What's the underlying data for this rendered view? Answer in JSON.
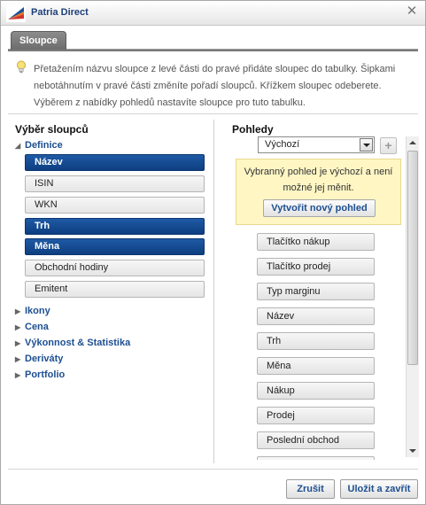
{
  "window": {
    "title": "Patria Direct"
  },
  "tabs": [
    {
      "label": "Sloupce",
      "active": true
    }
  ],
  "info": {
    "lines": [
      "Přetažením názvu sloupce z levé části do pravé přidáte sloupec do tabulky. Šipkami",
      "nebotáhnutím v pravé části změníte pořadí sloupců. Křížkem sloupec odeberete.",
      "Výběrem z nabídky pohledů nastavíte sloupce pro tuto tabulku."
    ]
  },
  "left": {
    "title": "Výběr sloupců",
    "groups": [
      {
        "label": "Definice",
        "expanded": true,
        "items": [
          {
            "label": "Název",
            "selected": true
          },
          {
            "label": "ISIN",
            "selected": false
          },
          {
            "label": "WKN",
            "selected": false
          },
          {
            "label": "Trh",
            "selected": true
          },
          {
            "label": "Měna",
            "selected": true
          },
          {
            "label": "Obchodní hodiny",
            "selected": false
          },
          {
            "label": "Emitent",
            "selected": false
          }
        ]
      },
      {
        "label": "Ikony",
        "expanded": false
      },
      {
        "label": "Cena",
        "expanded": false
      },
      {
        "label": "Výkonnost & Statistika",
        "expanded": false
      },
      {
        "label": "Deriváty",
        "expanded": false
      },
      {
        "label": "Portfolio",
        "expanded": false
      }
    ]
  },
  "right": {
    "title": "Pohledy",
    "view_select": {
      "value": "Výchozí"
    },
    "notice": {
      "lines": [
        "Vybranný pohled je výchozí a není",
        "možné jej měnit."
      ],
      "create_label": "Vytvořit nový pohled"
    },
    "columns": [
      "Tlačítko nákup",
      "Tlačítko prodej",
      "Typ marginu",
      "Název",
      "Trh",
      "Měna",
      "Nákup",
      "Prodej",
      "Poslední obchod",
      ""
    ]
  },
  "footer": {
    "cancel_label": "Zrušit",
    "save_label": "Uložit a zavřít"
  },
  "colors": {
    "accent": "#1d4f91",
    "selected": "#0e3e80",
    "notice": "#fff6c4"
  }
}
